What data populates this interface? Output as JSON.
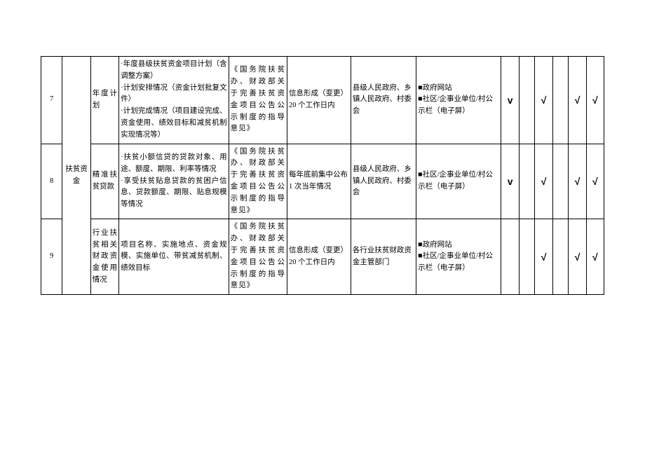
{
  "category": "扶贫资金",
  "rows": [
    {
      "idx": "7",
      "sub": "年度计划",
      "content": "·年度县级扶贫资金项目计划（含调整方案）\n·计划安排情况（资金计划批复文件）\n·计划完成情况（项目建设完成、资金使用、绩效目标和减贫机制实现情况等）",
      "basis": "《国务院扶贫办、财政部关于完善扶贫资金项目公告公示制度的指导意见》",
      "time": "信息形成（变更）20 个工作日内",
      "org": "县级人民政府、乡镇人民政府、村委会",
      "channel": "■政府网站\n■社区/企事业单位/村公示栏（电子屏）",
      "chk1": "v",
      "chk2": "",
      "chk3": "√",
      "chk4": "",
      "chk5": "√",
      "chk6": "√"
    },
    {
      "idx": "8",
      "sub": "精准扶贫贷款",
      "content": "·扶贫小额信贷的贷款对象、用途、额度、期限、利率等情况\n·享受扶贫贴息贷款的贫困户信息、贷款额度、期限、贴息规模等情况",
      "basis": "《国务院扶贫办、财政部关于完善扶贫资金项目公告公示制度的指导意见》",
      "time": "每年底前集中公布 1 次当年情况",
      "org": "县级人民政府、乡镇人民政府、村委会",
      "channel": "■社区/企事业单位/村公示栏（电子屏）",
      "chk1": "v",
      "chk2": "",
      "chk3": "√",
      "chk4": "",
      "chk5": "√",
      "chk6": "√"
    },
    {
      "idx": "9",
      "sub": "行业扶贫相关财政资金使用情况",
      "content": "项目名称、实施地点、资金规模、实施单位、带贫减贫机制、绩效目标",
      "basis": "《国务院扶贫办、财政部关于完善扶贫资金项目公告公示制度的指导意见》",
      "time": "信息形成（变更）20 个工作日内",
      "org": "各行业扶贫财政资金主管部门",
      "channel": "■政府网站\n■社区/企事业单位/村公示栏（电子屏）",
      "chk1": "",
      "chk2": "",
      "chk3": "√",
      "chk4": "",
      "chk5": "√",
      "chk6": "√"
    }
  ]
}
